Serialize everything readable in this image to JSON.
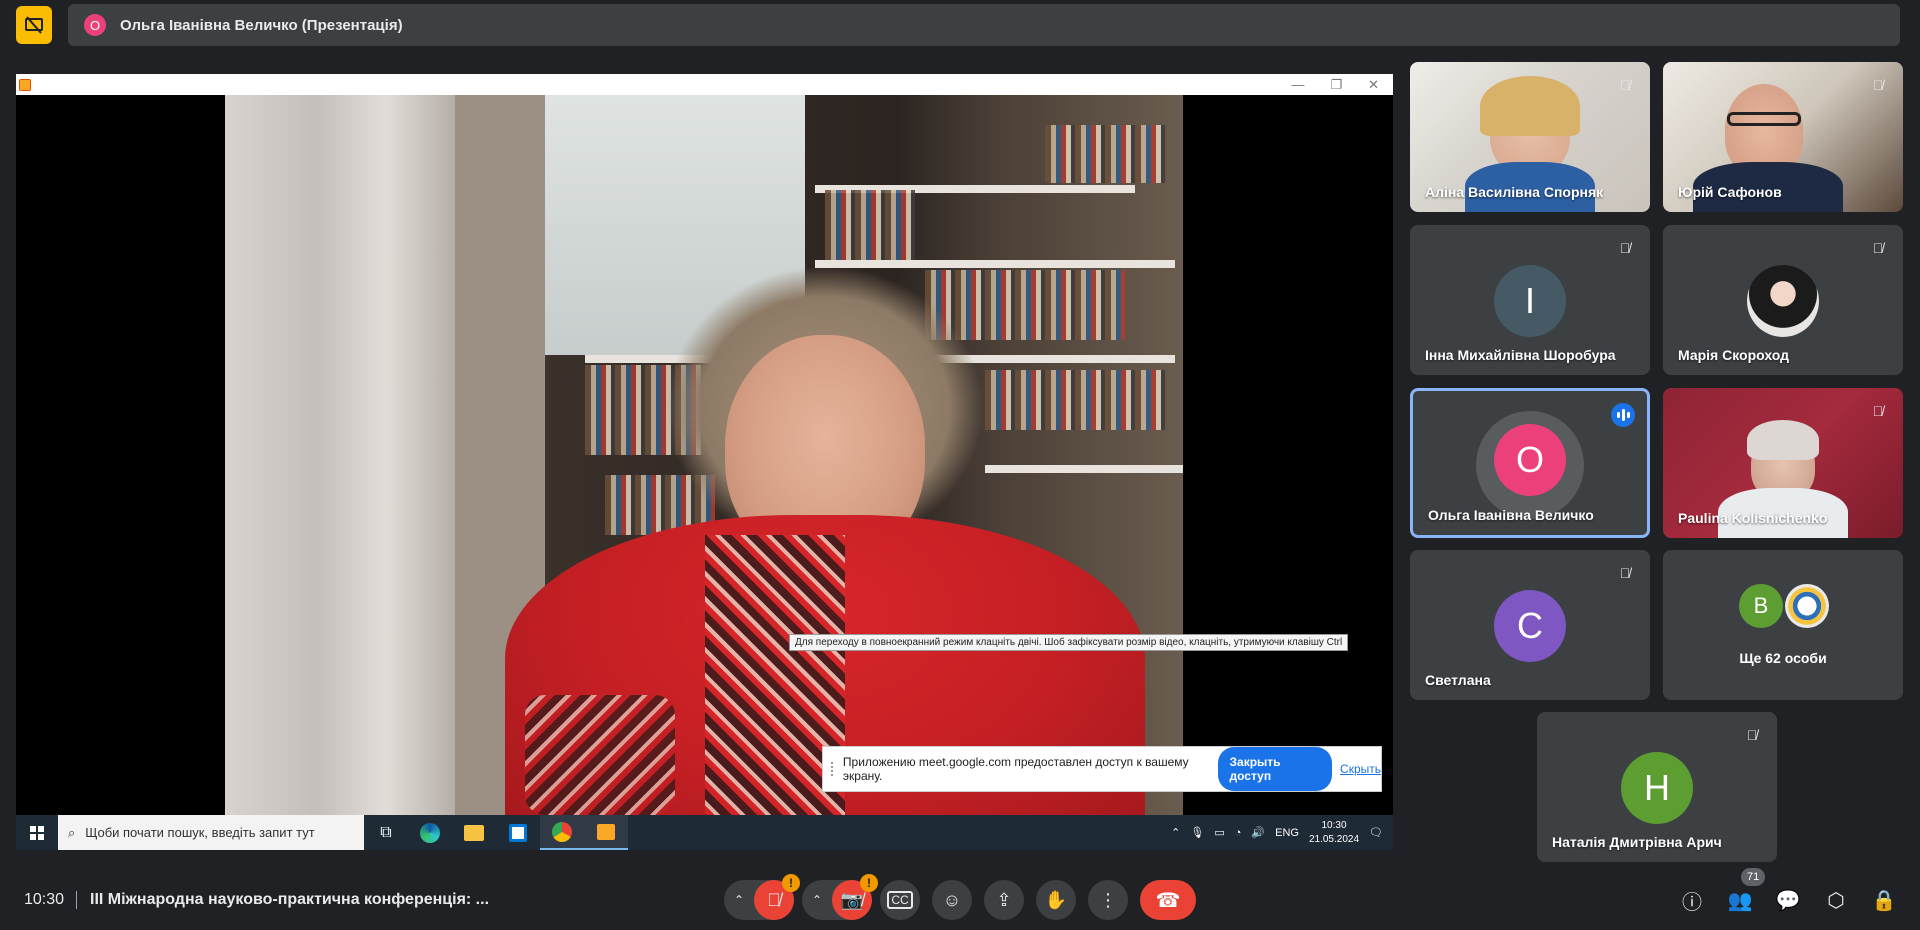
{
  "header": {
    "presenter_initial": "О",
    "presentation_title": "Ольга Іванівна Величко (Презентація)"
  },
  "shared_screen": {
    "tooltip": "Для переходу в повноекранний режим клацніть двічі. Шоб зафіксувати розмір відео, клацніть, утримуючи клавішу Ctrl",
    "share_notice": {
      "text": "Приложению meet.google.com предоставлен доступ к вашему экрану.",
      "stop_button": "Закрыть доступ",
      "hide_link": "Скрыть"
    },
    "taskbar": {
      "search_placeholder": "Щоби почати пошук, введіть запит тут",
      "language": "ENG",
      "time": "10:30",
      "date": "21.05.2024"
    }
  },
  "participants": [
    {
      "name": "Аліна Василівна Спорняк",
      "type": "camera",
      "muted": true
    },
    {
      "name": "Юрій Сафонов",
      "type": "camera",
      "muted": true
    },
    {
      "name": "Інна Михайлівна Шоробура",
      "type": "avatar",
      "initial": "І",
      "color": "#455a64",
      "muted": true
    },
    {
      "name": "Марія Скороход",
      "type": "photo",
      "muted": true
    },
    {
      "name": "Ольга Іванівна Величко",
      "type": "avatar",
      "initial": "О",
      "color": "#ec407a",
      "speaking": true
    },
    {
      "name": "Paulina Kolisnichenko",
      "type": "camera",
      "muted": true
    },
    {
      "name": "Светлана",
      "type": "avatar",
      "initial": "С",
      "color": "#7e57c2",
      "muted": true
    },
    {
      "name": "Наталія Дмитрівна Арич",
      "type": "avatar",
      "initial": "Н",
      "color": "#5c9e31",
      "muted": true
    }
  ],
  "more_tile": {
    "label": "Ще 62 особи",
    "initial": "В",
    "color": "#5c9e31"
  },
  "bottom_bar": {
    "time": "10:30",
    "meeting_title": "ІІІ Міжнародна науково-практична конференція: ...",
    "people_count": "71"
  },
  "colors": {
    "background": "#202124",
    "tile": "#3c4043",
    "leave": "#ea4335",
    "accent": "#1a73e8",
    "warning": "#f29900",
    "present_stop": "#fbbc04"
  }
}
